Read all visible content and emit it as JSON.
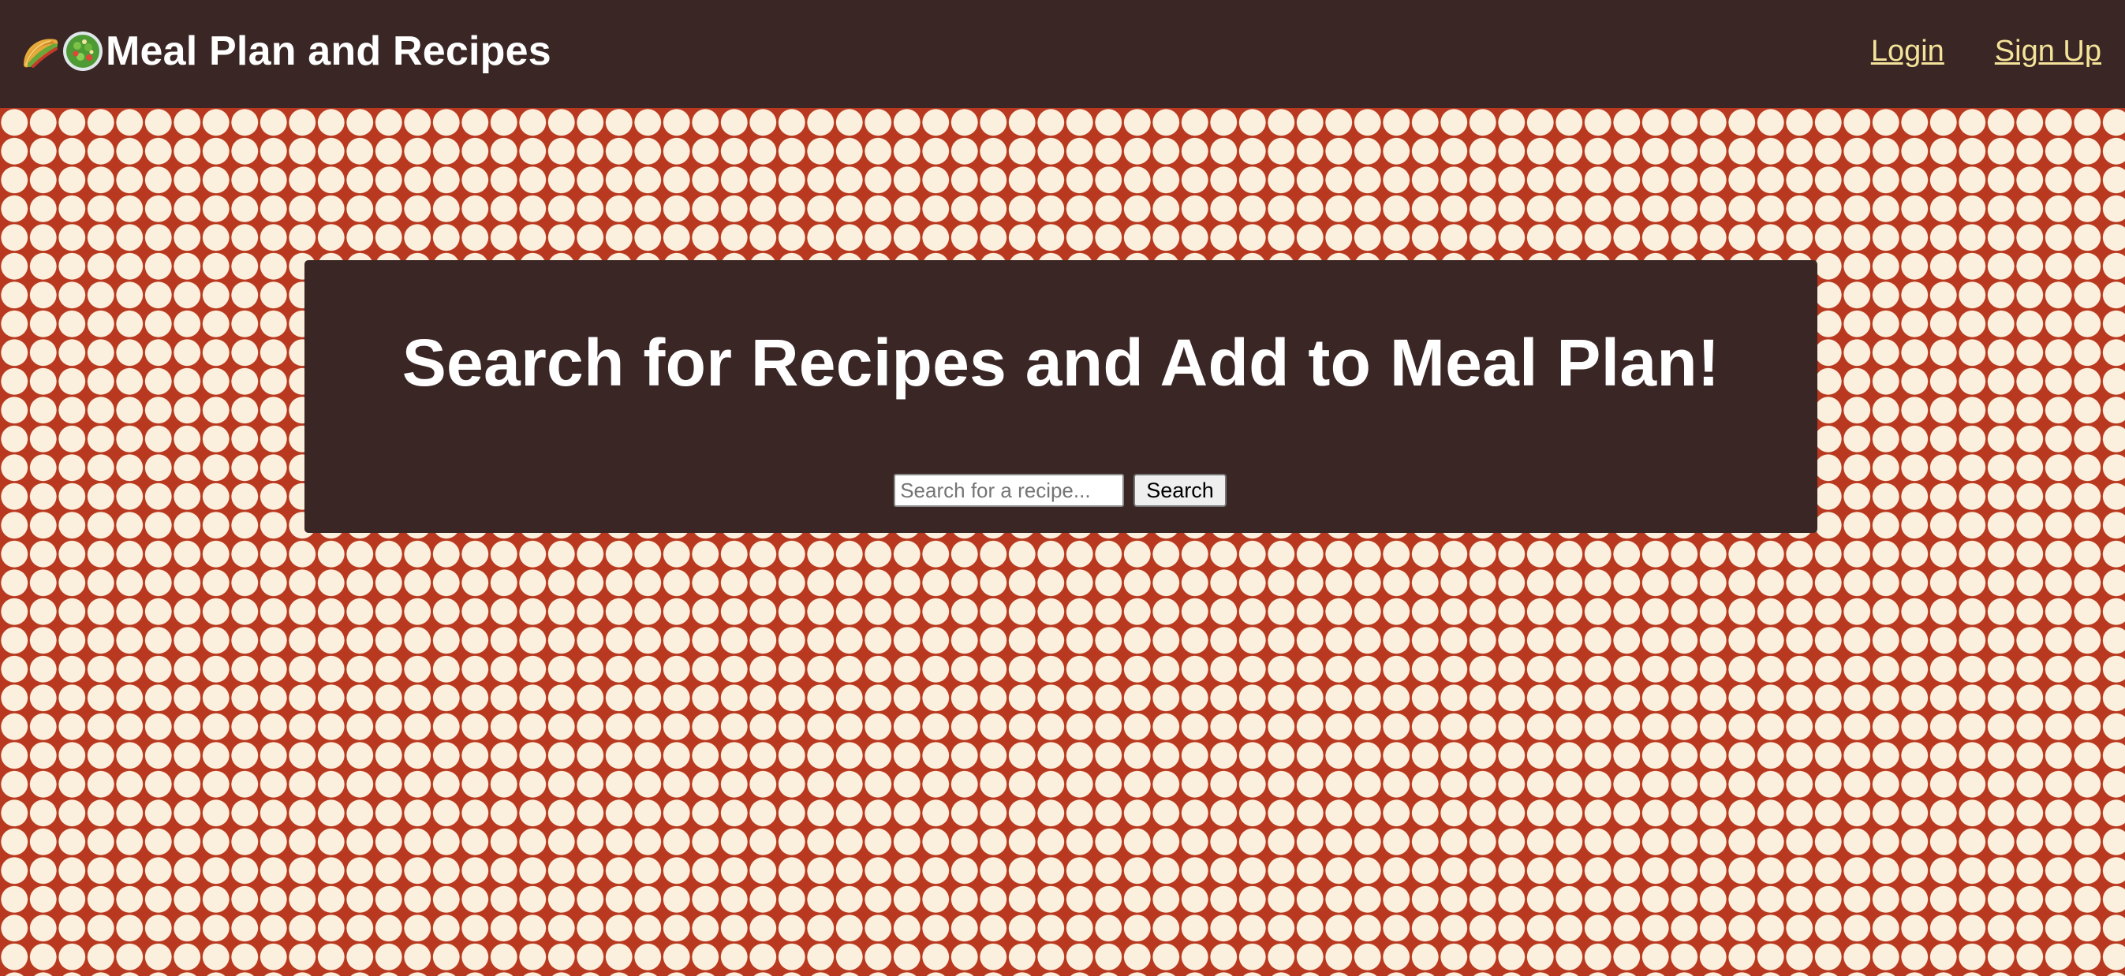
{
  "header": {
    "brand_title": "Meal Plan and Recipes",
    "brand_icons": [
      "taco-icon",
      "salad-icon"
    ],
    "links": {
      "login": "Login",
      "signup": "Sign Up"
    }
  },
  "hero": {
    "title": "Search for Recipes and Add to Meal Plan!",
    "search": {
      "placeholder": "Search for a recipe...",
      "value": "",
      "button_label": "Search"
    }
  },
  "colors": {
    "navbar_bg": "#3a2725",
    "hero_bg": "#3a2725",
    "link": "#f4e39a",
    "pattern_red": "#b8391f",
    "pattern_cream": "#fbf0de"
  }
}
